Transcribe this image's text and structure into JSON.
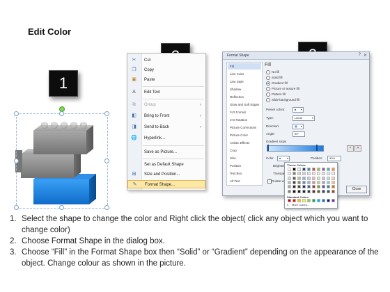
{
  "title": "Edit Color",
  "steps": {
    "badge_1": "1",
    "badge_2": "2",
    "badge_3": "3"
  },
  "context_menu": {
    "items": [
      {
        "label": "Cut",
        "icon": "scissors-icon",
        "enabled": true,
        "submenu": false
      },
      {
        "label": "Copy",
        "icon": "copy-icon",
        "enabled": true,
        "submenu": false
      },
      {
        "label": "Paste",
        "icon": "clipboard-icon",
        "enabled": true,
        "submenu": false
      },
      {
        "label": "Edit Text",
        "icon": "edit-text-icon",
        "enabled": true,
        "submenu": false
      },
      {
        "label": "Group",
        "icon": "group-icon",
        "enabled": false,
        "submenu": true
      },
      {
        "label": "Bring to Front",
        "icon": "bring-front-icon",
        "enabled": true,
        "submenu": true
      },
      {
        "label": "Send to Back",
        "icon": "send-back-icon",
        "enabled": true,
        "submenu": true
      },
      {
        "label": "Hyperlink...",
        "icon": "hyperlink-icon",
        "enabled": true,
        "submenu": false
      },
      {
        "label": "Save as Picture...",
        "icon": "",
        "enabled": true,
        "submenu": false
      },
      {
        "label": "Set as Default Shape",
        "icon": "",
        "enabled": true,
        "submenu": false
      },
      {
        "label": "Size and Position...",
        "icon": "size-icon",
        "enabled": true,
        "submenu": false
      },
      {
        "label": "Format Shape...",
        "icon": "format-shape-icon",
        "enabled": true,
        "submenu": false,
        "highlighted": true
      }
    ]
  },
  "format_dialog": {
    "title": "Format Shape",
    "nav": [
      "Fill",
      "Line Color",
      "Line Style",
      "Shadow",
      "Reflection",
      "Glow and Soft Edges",
      "3-D Format",
      "3-D Rotation",
      "Picture Corrections",
      "Picture Color",
      "Artistic Effects",
      "Crop",
      "Size",
      "Position",
      "Text Box",
      "Alt Text"
    ],
    "selected_nav": "Fill",
    "section_title": "Fill",
    "fill_options": [
      "No fill",
      "Solid fill",
      "Gradient fill",
      "Picture or texture fill",
      "Pattern fill",
      "Slide background fill"
    ],
    "selected_fill": "Gradient fill",
    "preset_label": "Preset colors:",
    "type_label": "Type:",
    "type_value": "Linear",
    "direction_label": "Direction:",
    "angle_label": "Angle:",
    "angle_value": "90°",
    "stops_label": "Gradient stops",
    "color_label": "Color",
    "position_label": "Position:",
    "position_value": "90%",
    "brightness_label": "Brightness:",
    "transparency_label": "Transparency:",
    "rotate_label": "Rotate with shape",
    "close_label": "Close"
  },
  "color_popup": {
    "theme_label": "Theme Colors",
    "standard_label": "Standard Colors",
    "more_label": "More Colors...",
    "theme_rows": [
      [
        "#ffffff",
        "#000000",
        "#eeece1",
        "#1f497d",
        "#4f81bd",
        "#c0504d",
        "#9bbb59",
        "#8064a2",
        "#4bacc6",
        "#f79646"
      ],
      [
        "#f2f2f2",
        "#7f7f7f",
        "#ddd9c3",
        "#c6d9f0",
        "#dbe5f1",
        "#f2dcdb",
        "#ebf1dd",
        "#e5e0ec",
        "#dbeef3",
        "#fdeada"
      ],
      [
        "#d8d8d8",
        "#595959",
        "#c4bd97",
        "#8db3e2",
        "#b8cce4",
        "#e5b9b7",
        "#d7e3bc",
        "#ccc1d9",
        "#b7dde8",
        "#fbd5b5"
      ],
      [
        "#bfbfbf",
        "#3f3f3f",
        "#938953",
        "#548dd4",
        "#95b3d7",
        "#d99694",
        "#c3d69b",
        "#b2a2c7",
        "#92cddc",
        "#fac08f"
      ],
      [
        "#a5a5a5",
        "#262626",
        "#494429",
        "#17365d",
        "#366092",
        "#953734",
        "#76923c",
        "#5f497a",
        "#31859b",
        "#e36c09"
      ],
      [
        "#7f7f7f",
        "#0c0c0c",
        "#1d1b10",
        "#0f243e",
        "#244061",
        "#632423",
        "#4f6128",
        "#3f3151",
        "#205867",
        "#974806"
      ]
    ],
    "standard_row": [
      "#c00000",
      "#ff0000",
      "#ffc000",
      "#ffff00",
      "#92d050",
      "#00b050",
      "#00b0f0",
      "#0070c0",
      "#002060",
      "#7030a0"
    ]
  },
  "instructions": [
    {
      "num": "1.",
      "text": "Select the shape to change the color and Right click the object( click any object which you want to change color)"
    },
    {
      "num": "2.",
      "text": "Choose Format Shape in the dialog box."
    },
    {
      "num": "3.",
      "text": "Choose “Fill” in the Format Shape box then “Solid” or “Gradient” depending on the appearance of the object. Change colour as shown in the picture."
    }
  ],
  "colors": {
    "brick_gray": "#8c8c8c",
    "brick_blue": "#1e88e5",
    "menu_highlight": "#fde7a6"
  }
}
